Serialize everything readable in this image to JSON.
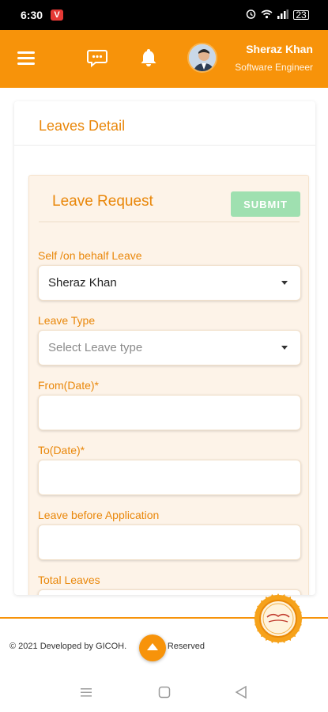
{
  "status_bar": {
    "time": "6:30",
    "app_badge": "V",
    "battery": "23"
  },
  "app_bar": {
    "user_name": "Sheraz Khan",
    "user_role": "Software Engineer",
    "icons": [
      "menu-icon",
      "chat-icon",
      "bell-icon",
      "avatar"
    ]
  },
  "page": {
    "title": "Leaves Detail"
  },
  "leave_request": {
    "title": "Leave Request",
    "submit_label": "SUBMIT",
    "fields": {
      "behalf_label": "Self /on behalf Leave",
      "behalf_value": "Sheraz Khan",
      "type_label": "Leave Type",
      "type_placeholder": "Select Leave type",
      "from_label": "From(Date)*",
      "to_label": "To(Date)*",
      "before_label": "Leave before Application",
      "total_label": "Total Leaves"
    }
  },
  "footer": {
    "copyright_prefix": "© 2021 Developed by GICOH.",
    "copyright_suffix": "hts Reserved"
  },
  "colors": {
    "accent": "#f7930a",
    "label": "#e9870a",
    "submit": "#9fe0b0"
  }
}
